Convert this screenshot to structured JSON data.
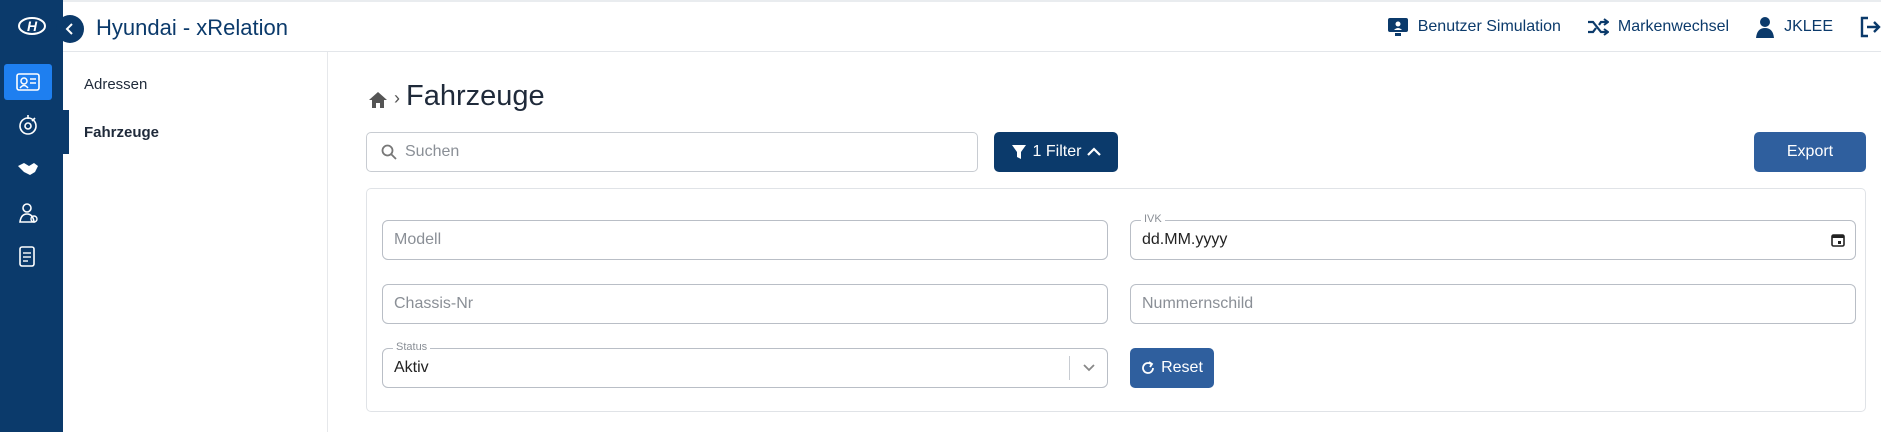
{
  "app": {
    "title": "Hyundai - xRelation"
  },
  "top_actions": {
    "user_simulation": "Benutzer Simulation",
    "brand_switch": "Markenwechsel",
    "username": "JKLEE"
  },
  "subnav": {
    "items": [
      {
        "label": "Adressen"
      },
      {
        "label": "Fahrzeuge"
      }
    ]
  },
  "page": {
    "title": "Fahrzeuge"
  },
  "search": {
    "placeholder": "Suchen"
  },
  "filter_button": {
    "label": "1 Filter"
  },
  "export_button": {
    "label": "Export"
  },
  "filters": {
    "modell": {
      "placeholder": "Modell"
    },
    "ivk": {
      "label": "IVK",
      "value": "dd.MM.yyyy"
    },
    "chassis": {
      "placeholder": "Chassis-Nr"
    },
    "nummernschild": {
      "placeholder": "Nummernschild"
    },
    "status": {
      "label": "Status",
      "value": "Aktiv"
    },
    "reset_label": "Reset"
  },
  "colors": {
    "primary": "#0b3a6b",
    "accent": "#1e7ff0",
    "button": "#2f5f9e"
  }
}
